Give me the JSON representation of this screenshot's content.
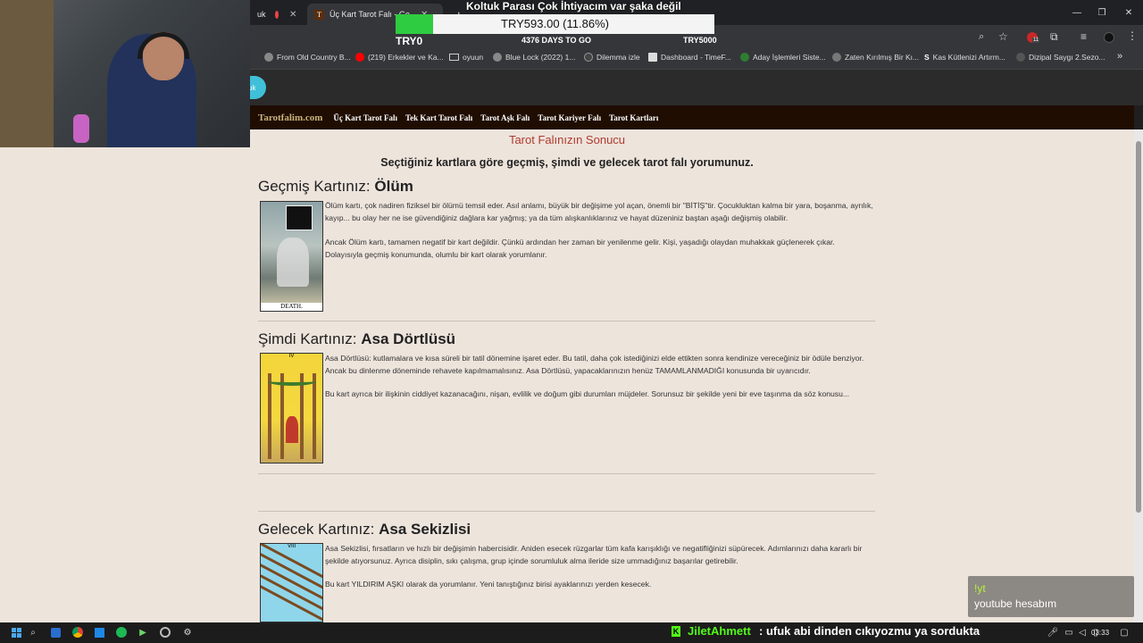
{
  "stream": {
    "donation_title": "Koltuk Parası Çok İhtiyacım var şaka değil",
    "goal_amount": "TRY593.00 (11.86%)",
    "goal_progress": 0.1186,
    "goal_left": "TRY0",
    "goal_days": "4376 DAYS TO GO",
    "goal_right": "TRY5000",
    "chat_bang": "!yt",
    "chat_bang_text": "youtube hesabım",
    "ticker_user": "JiletAhmett",
    "ticker_msg": ": ufuk abi dinden cıkıyozmu ya sordukta"
  },
  "browser": {
    "tab_left_partial": "uk",
    "tab_active_title": "Üç Kart Tarot Falı - Geçmiş",
    "new_tab": "+",
    "bookmarks": [
      {
        "label": "From Old Country B...",
        "color": "#888888"
      },
      {
        "label": "(219) Erkekler ve Ka...",
        "color": "#ff0000"
      },
      {
        "label": "oyuun",
        "color": "#c0c0c0"
      },
      {
        "label": "Blue Lock (2022) 1...",
        "color": "#888888"
      },
      {
        "label": "Dilemma izle",
        "color": "#444444"
      },
      {
        "label": "Dashboard - TimeF...",
        "color": "#dddddd"
      },
      {
        "label": "Aday İşlemleri Siste...",
        "color": "#2e7d32"
      },
      {
        "label": "Zaten Kırılmış Bir Kı...",
        "color": "#777777"
      },
      {
        "label": "Kas Kütlenizi Artırm...",
        "color": "#ffffff"
      },
      {
        "label": "Dizipal Saygı 2.Sezo...",
        "color": "#555555"
      }
    ],
    "bookmarks_more": "»",
    "clock": "03:33",
    "notif_badge": "11"
  },
  "site": {
    "logo": "Tarotfalim.com",
    "nav": [
      "Üç Kart Tarot Falı",
      "Tek Kart Tarot Falı",
      "Tarot Aşk Falı",
      "Tarot Kariyer Falı",
      "Tarot Kartları"
    ],
    "page_title": "Tarot Falınızın Sonucu",
    "page_sub": "Seçtiğiniz kartlara göre geçmiş, şimdi ve gelecek tarot falı yorumunuz.",
    "sections": [
      {
        "prefix": "Geçmiş Kartınız: ",
        "card": "Ölüm",
        "card_caption": "DEATH.",
        "p1": "Ölüm kartı, çok nadiren fiziksel bir ölümü temsil eder. Asıl anlamı, büyük bir değişime yol açan, önemli bir \"BİTİŞ\"tir. Çocukluktan kalma bir yara, boşanma, ayrılık, kayıp... bu olay her ne ise güvendiğiniz dağlara kar yağmış; ya da tüm alışkanlıklarınız ve hayat düzeniniz baştan aşağı değişmiş olabilir.",
        "p2": "Ancak Ölüm kartı, tamamen negatif bir kart değildir. Çünkü ardından her zaman bir yenilenme gelir. Kişi, yaşadığı olaydan muhakkak güçlenerek çıkar. Dolayısıyla geçmiş konumunda, olumlu bir kart olarak yorumlanır."
      },
      {
        "prefix": "Şimdi Kartınız: ",
        "card": "Asa Dörtlüsü",
        "card_caption": "IV",
        "p1": "Asa Dörtlüsü: kutlamalara ve kısa süreli bir tatil dönemine işaret eder. Bu tatil, daha çok istediğinizi elde ettikten sonra kendinize vereceğiniz bir ödüle benziyor. Ancak bu dinlenme döneminde rehavete kapılmamalısınız. Asa Dörtlüsü, yapacaklarınızın henüz TAMAMLANMADIĞI konusunda bir uyarıcıdır.",
        "p2": "Bu kart ayrıca bir ilişkinin ciddiyet kazanacağını, nişan, evlilik ve doğum gibi durumları müjdeler. Sorunsuz bir şekilde yeni bir eve taşınma da söz konusu..."
      },
      {
        "prefix": "Gelecek Kartınız: ",
        "card": "Asa Sekizlisi",
        "card_caption": "VIII",
        "p1": "Asa Sekizlisi, fırsatların ve hızlı bir değişimin habercisidir. Aniden esecek rüzgarlar tüm kafa karışıklığı ve negatifliğinizi süpürecek. Adımlarınızı daha kararlı bir şekilde atıyorsunuz. Ayrıca disiplin, sıkı çalışma, grup içinde sorumluluk alma ileride size ummadığınız başarılar getirebilir.",
        "p2": "Bu kart YILDIRIM AŞKI olarak da yorumlanır. Yeni tanıştığınız birisi ayaklarınızı yerden kesecek."
      }
    ]
  }
}
